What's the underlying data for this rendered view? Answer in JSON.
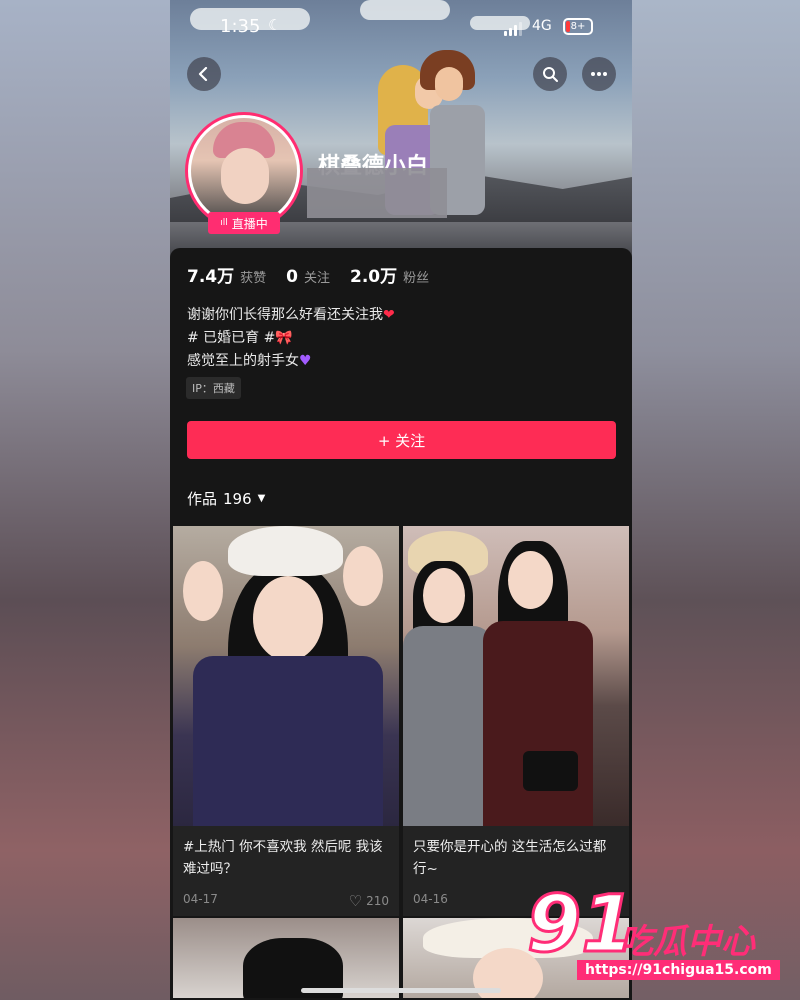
{
  "status_bar": {
    "time": "1:35",
    "network": "4G",
    "battery": "8+"
  },
  "profile": {
    "name": "棋叠德小白",
    "live_badge": "直播中",
    "stats": [
      {
        "value": "7.4万",
        "label": "获赞"
      },
      {
        "value": "0",
        "label": "关注"
      },
      {
        "value": "2.0万",
        "label": "粉丝"
      }
    ],
    "bio_lines": [
      "谢谢你们长得那么好看还关注我",
      "# 已婚已育 #",
      "感觉至上的射手女"
    ],
    "ip": "IP：西藏",
    "follow_label": "+ 关注"
  },
  "works": {
    "label": "作品",
    "count": "196"
  },
  "videos": [
    {
      "caption": "#上热门 你不喜欢我 然后呢 我该难过吗？",
      "date": "04-17",
      "likes": "210"
    },
    {
      "caption": "只要你是开心的 这生活怎么过都行~",
      "date": "04-16",
      "likes": ""
    }
  ],
  "watermark": {
    "number": "91",
    "text": "吃瓜中心",
    "url": "https://91chigua15.com"
  },
  "icons": {
    "back": "back-icon",
    "search": "search-icon",
    "more": "more-icon",
    "heart": "heart-icon",
    "caret": "caret-down-icon",
    "live": "live-bars-icon"
  },
  "colors": {
    "accent": "#fe2c55",
    "background": "#161616"
  }
}
